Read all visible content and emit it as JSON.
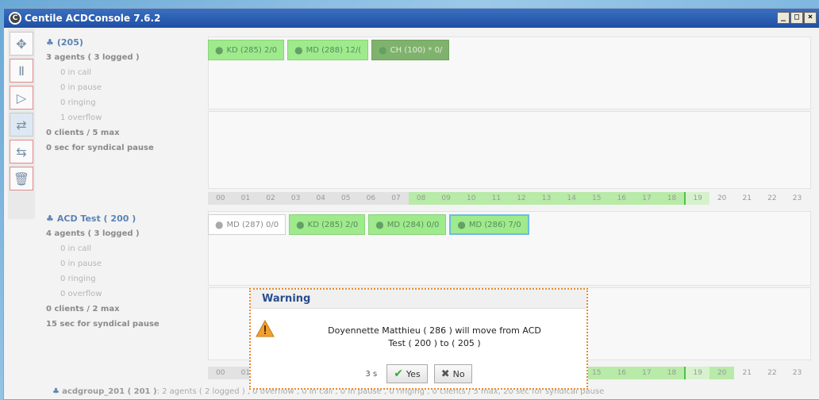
{
  "window": {
    "title": "Centile ACDConsole 7.6.2",
    "logo_letter": "C",
    "controls": [
      "_",
      "□",
      "×"
    ]
  },
  "toolbar": {
    "icons": [
      "move-arrows-icon",
      "pause-icon",
      "play-icon",
      "transfer-icon",
      "transfer-out-icon",
      "trash-icon"
    ]
  },
  "queue1": {
    "title": "(205)",
    "agents_line": "3 agents ( 3 logged )",
    "in_call": "0 in call",
    "in_pause": "0 in pause",
    "ringing": "0 ringing",
    "overflow": "1 overflow",
    "clients": "0 clients / 5 max",
    "syndical": "0 sec for syndical pause",
    "agents": [
      {
        "label": "KD (285)  2/0"
      },
      {
        "label": "MD (288)  12/("
      },
      {
        "label": "CH (100) *  0/"
      }
    ]
  },
  "queue2": {
    "title": "ACD Test ( 200 )",
    "agents_line": "4 agents ( 3 logged )",
    "in_call": "0 in call",
    "in_pause": "0 in pause",
    "ringing": "0 ringing",
    "overflow": "0 overflow",
    "clients": "0 clients / 2 max",
    "syndical": "15 sec for syndical pause",
    "agents": [
      {
        "label": "MD (287)  0/0"
      },
      {
        "label": "KD (285)  2/0"
      },
      {
        "label": "MD (284)  0/0"
      },
      {
        "label": "MD (286)  7/0"
      }
    ]
  },
  "timeline": {
    "hours": [
      "00",
      "01",
      "02",
      "03",
      "04",
      "05",
      "06",
      "07",
      "08",
      "09",
      "10",
      "11",
      "12",
      "13",
      "14",
      "15",
      "16",
      "17",
      "18",
      "19",
      "20",
      "21",
      "22",
      "23"
    ]
  },
  "bottom": {
    "group": "acdgroup_201 ( 201 )",
    "detail": ": 2 agents ( 2 logged ) , 0 overflow , 0 in call , 0 in pause , 0 ringing , 0 clients / 5 max, 20 sec for syndical pause"
  },
  "dialog": {
    "title": "Warning",
    "message_line1": "Doyennette Matthieu ( 286 ) will move from ACD",
    "message_line2": "Test ( 200 ) to  ( 205 )",
    "countdown": "3 s",
    "yes_label": "Yes",
    "no_label": "No"
  }
}
